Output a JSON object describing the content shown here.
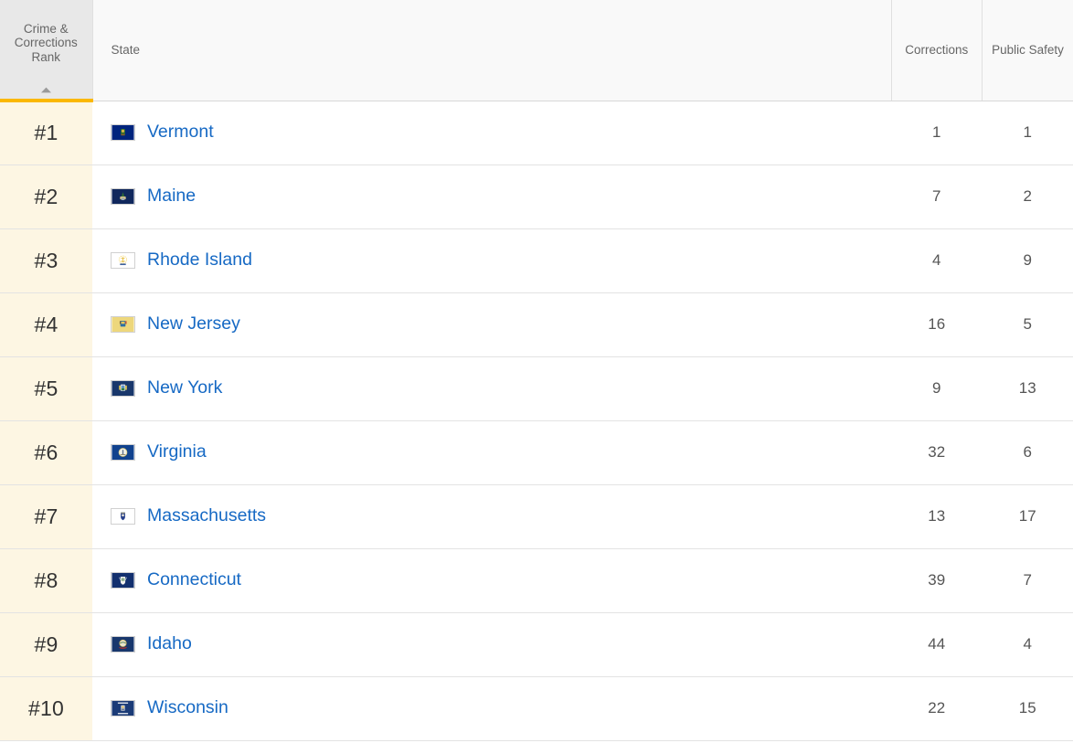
{
  "table": {
    "columns": {
      "rank": "Crime & Corrections Rank",
      "state": "State",
      "corrections": "Corrections",
      "public_safety": "Public Safety"
    },
    "sort": {
      "column": "Crime & Corrections Rank",
      "direction": "ascending",
      "icon": "sort-ascending-caret-icon",
      "accent_color": "#fbb800"
    },
    "colors": {
      "rank_cell_background": "#fdf6e3",
      "header_rank_background": "#e8e8e8",
      "header_background": "#f9f9f9",
      "link": "#1669c4",
      "row_divider": "#e3e3e3"
    },
    "rows": [
      {
        "rank": "#1",
        "state": "Vermont",
        "flag_icon": "flag-vermont-icon",
        "corrections": "1",
        "public_safety": "1"
      },
      {
        "rank": "#2",
        "state": "Maine",
        "flag_icon": "flag-maine-icon",
        "corrections": "7",
        "public_safety": "2"
      },
      {
        "rank": "#3",
        "state": "Rhode Island",
        "flag_icon": "flag-rhode-island-icon",
        "corrections": "4",
        "public_safety": "9"
      },
      {
        "rank": "#4",
        "state": "New Jersey",
        "flag_icon": "flag-new-jersey-icon",
        "corrections": "16",
        "public_safety": "5"
      },
      {
        "rank": "#5",
        "state": "New York",
        "flag_icon": "flag-new-york-icon",
        "corrections": "9",
        "public_safety": "13"
      },
      {
        "rank": "#6",
        "state": "Virginia",
        "flag_icon": "flag-virginia-icon",
        "corrections": "32",
        "public_safety": "6"
      },
      {
        "rank": "#7",
        "state": "Massachusetts",
        "flag_icon": "flag-massachusetts-icon",
        "corrections": "13",
        "public_safety": "17"
      },
      {
        "rank": "#8",
        "state": "Connecticut",
        "flag_icon": "flag-connecticut-icon",
        "corrections": "39",
        "public_safety": "7"
      },
      {
        "rank": "#9",
        "state": "Idaho",
        "flag_icon": "flag-idaho-icon",
        "corrections": "44",
        "public_safety": "4"
      },
      {
        "rank": "#10",
        "state": "Wisconsin",
        "flag_icon": "flag-wisconsin-icon",
        "corrections": "22",
        "public_safety": "15"
      }
    ]
  }
}
